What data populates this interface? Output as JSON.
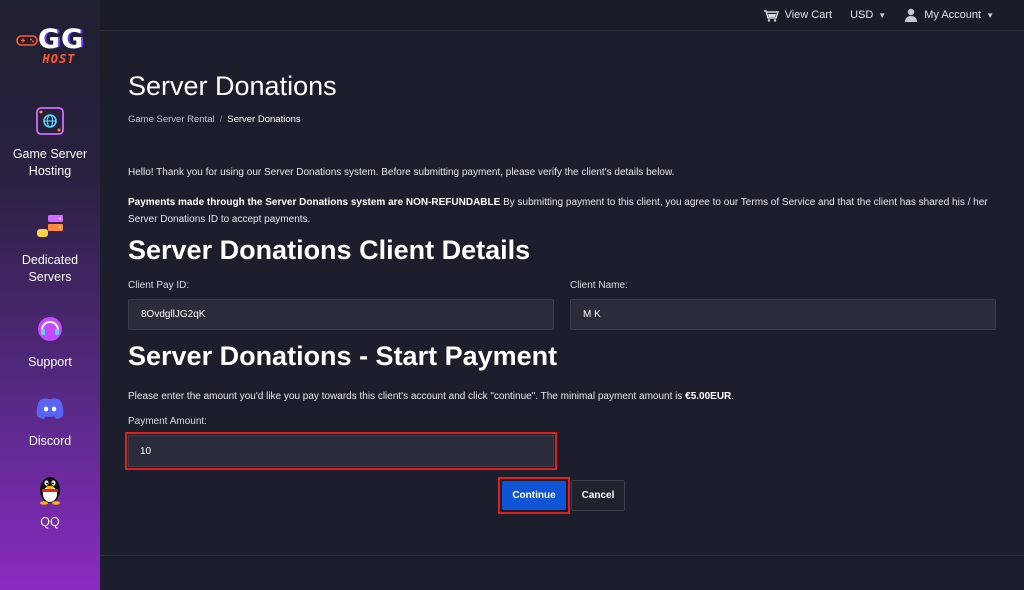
{
  "topbar": {
    "view_cart": "View Cart",
    "currency": "USD",
    "account": "My Account"
  },
  "sidebar": {
    "logo": {
      "letters": "GG",
      "host": "HOST"
    },
    "items": [
      {
        "label": "Game Server Hosting",
        "icon": "game-server-icon"
      },
      {
        "label": "Dedicated Servers",
        "icon": "dedicated-server-icon"
      },
      {
        "label": "Support",
        "icon": "support-headset-icon"
      },
      {
        "label": "Discord",
        "icon": "discord-icon"
      },
      {
        "label": "QQ",
        "icon": "qq-penguin-icon"
      }
    ]
  },
  "page": {
    "title": "Server Donations",
    "breadcrumb": {
      "parent": "Game Server Rental",
      "separator": "/",
      "current": "Server Donations"
    },
    "intro": "Hello! Thank you for using our Server Donations system. Before submitting payment, please verify the client's details below.",
    "notice_bold": "Payments made through the Server Donations system are NON-REFUNDABLE",
    "notice_text": " By submitting payment to this client, you agree to our Terms of Service and that the client has shared his / her Server Donations ID to accept payments."
  },
  "client_details": {
    "heading": "Server Donations Client Details",
    "pay_id_label": "Client Pay ID:",
    "pay_id_value": "8OvdgllJG2qK",
    "name_label": "Client Name:",
    "name_value": "M K"
  },
  "payment": {
    "heading": "Server Donations - Start Payment",
    "instructions": "Please enter the amount you'd like you pay towards this client's account and click \"continue\". The minimal payment amount is ",
    "minimum": "€5.00EUR",
    "instructions_end": ".",
    "amount_label": "Payment Amount:",
    "amount_value": "10",
    "continue_label": "Continue",
    "cancel_label": "Cancel"
  },
  "colors": {
    "background": "#1c1f2b",
    "primary_button": "#1054d6",
    "highlight_border": "#e02020",
    "logo_accent": "#ff5a2a"
  }
}
